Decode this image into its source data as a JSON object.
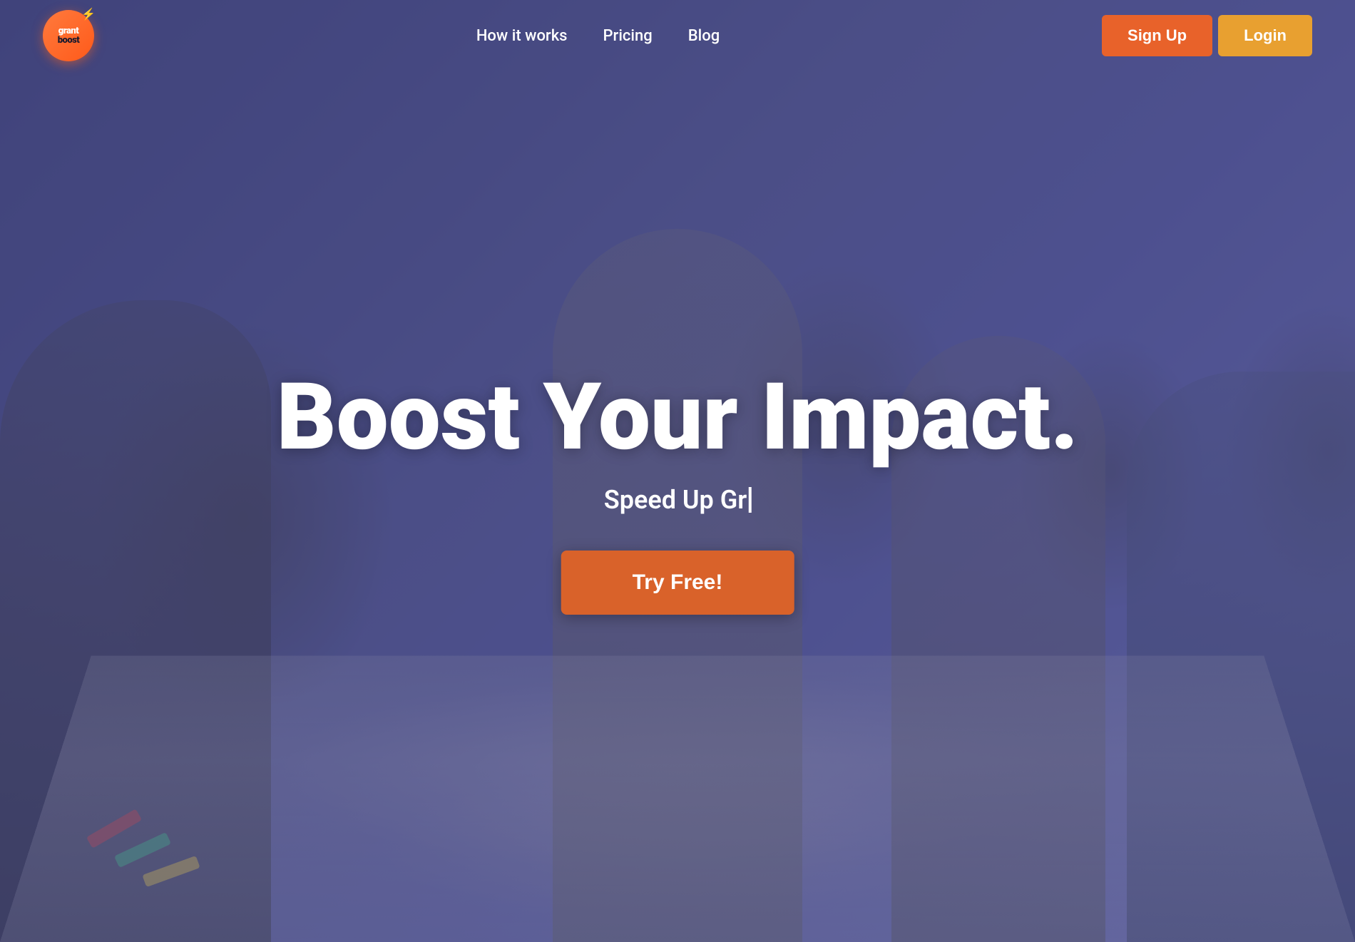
{
  "logo": {
    "text_grant": "grant",
    "text_boost": "boost",
    "alt": "GrantBoost Logo"
  },
  "navbar": {
    "links": [
      {
        "id": "how-it-works",
        "label": "How it works"
      },
      {
        "id": "pricing",
        "label": "Pricing"
      },
      {
        "id": "blog",
        "label": "Blog"
      }
    ],
    "btn_signup": "Sign Up",
    "btn_login": "Login"
  },
  "hero": {
    "headline": "Boost Your Impact.",
    "subheadline_prefix": "Speed Up Gr",
    "subheadline_suffix": "",
    "cta_label": "Try Free!",
    "accent_color": "#e8622a",
    "overlay_color": "rgba(70, 75, 140, 0.55)"
  },
  "colors": {
    "signup_btn": "#e8622a",
    "login_btn": "#e8a030",
    "cta_btn": "#d9622a",
    "logo_bg": "#ff6020",
    "nav_text": "#ffffff"
  }
}
